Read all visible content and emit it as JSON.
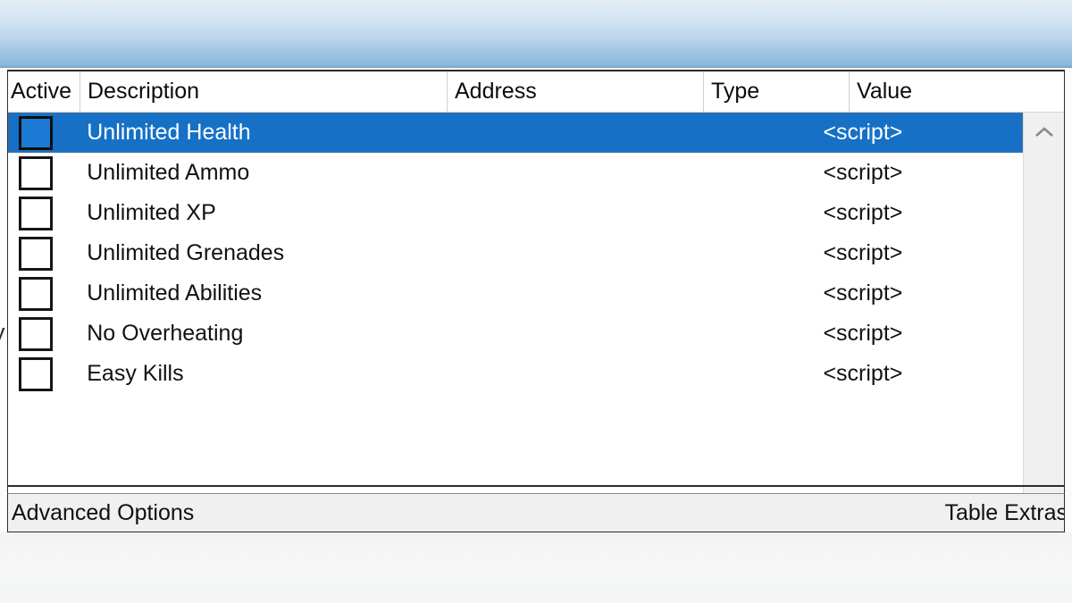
{
  "window": {
    "accent_selection_color": "#1671c6",
    "panel_background": "#ffffff",
    "backdrop_gradient_top": "#e4edf5",
    "backdrop_gradient_bottom": "#7fb0d8"
  },
  "table": {
    "columns": [
      {
        "key": "active",
        "label": "Active"
      },
      {
        "key": "description",
        "label": "Description"
      },
      {
        "key": "address",
        "label": "Address"
      },
      {
        "key": "type",
        "label": "Type"
      },
      {
        "key": "value",
        "label": "Value"
      }
    ],
    "rows": [
      {
        "active": false,
        "description": "Unlimited Health",
        "address": "",
        "type": "",
        "value": "<script>",
        "selected": true
      },
      {
        "active": false,
        "description": "Unlimited Ammo",
        "address": "",
        "type": "",
        "value": "<script>",
        "selected": false
      },
      {
        "active": false,
        "description": "Unlimited XP",
        "address": "",
        "type": "",
        "value": "<script>",
        "selected": false
      },
      {
        "active": false,
        "description": "Unlimited Grenades",
        "address": "",
        "type": "",
        "value": "<script>",
        "selected": false
      },
      {
        "active": false,
        "description": "Unlimited Abilities",
        "address": "",
        "type": "",
        "value": "<script>",
        "selected": false
      },
      {
        "active": false,
        "description": "No Overheating",
        "address": "",
        "type": "",
        "value": "<script>",
        "selected": false
      },
      {
        "active": false,
        "description": "Easy Kills",
        "address": "",
        "type": "",
        "value": "<script>",
        "selected": false
      }
    ]
  },
  "scrollbar": {
    "up_icon": "chevron-up-icon",
    "down_icon": "chevron-down-icon"
  },
  "statusbar": {
    "left_label": "Advanced Options",
    "right_label": "Table Extras"
  },
  "artifact": {
    "glyph": "y"
  }
}
